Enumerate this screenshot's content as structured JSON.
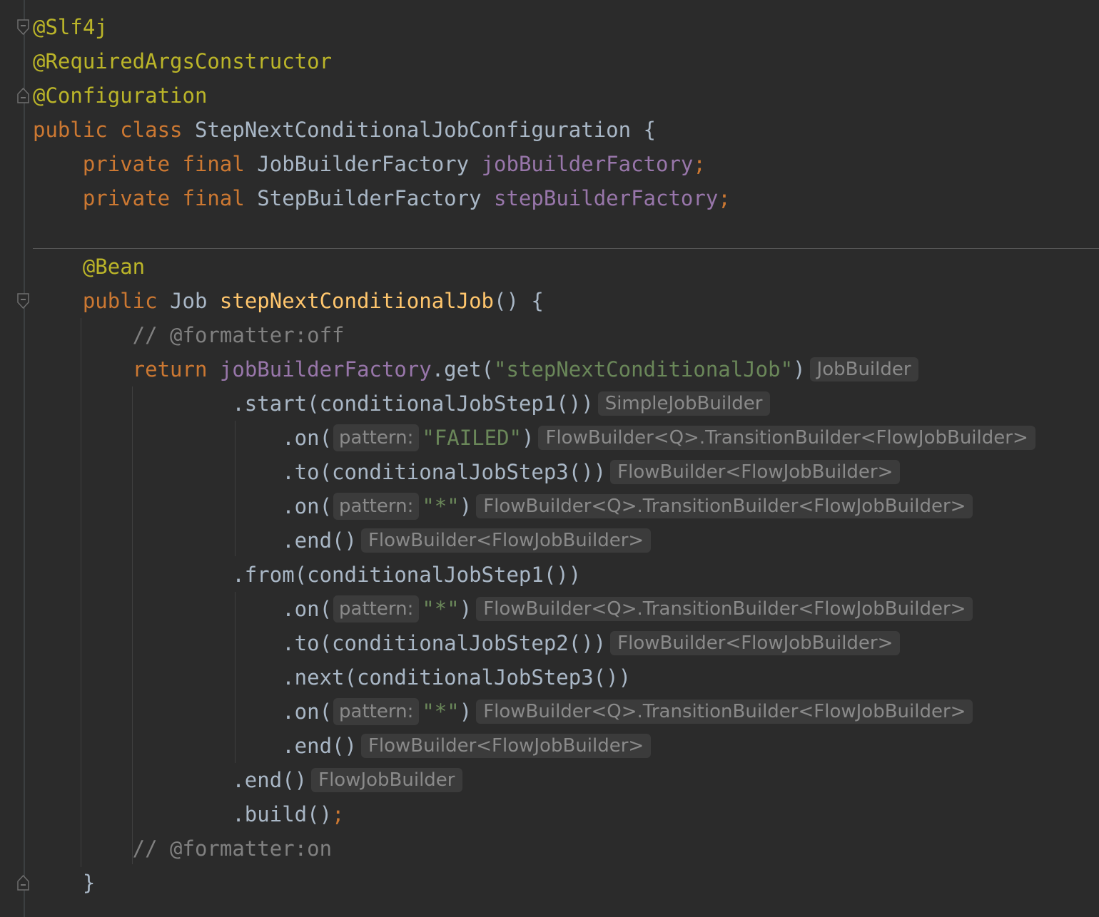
{
  "editor": {
    "lines": [
      [
        {
          "c": "ann",
          "t": "@Slf4j"
        }
      ],
      [
        {
          "c": "ann",
          "t": "@RequiredArgsConstructor"
        }
      ],
      [
        {
          "c": "ann",
          "t": "@Configuration"
        }
      ],
      [
        {
          "c": "kw",
          "t": "public class "
        },
        {
          "c": "cls",
          "t": "StepNextConditionalJobConfiguration "
        },
        {
          "c": "plain",
          "t": "{"
        }
      ],
      [
        {
          "c": "kw",
          "t": "    private final "
        },
        {
          "c": "cls",
          "t": "JobBuilderFactory "
        },
        {
          "c": "field",
          "t": "jobBuilderFactory"
        },
        {
          "c": "kw",
          "t": ";"
        }
      ],
      [
        {
          "c": "kw",
          "t": "    private final "
        },
        {
          "c": "cls",
          "t": "StepBuilderFactory "
        },
        {
          "c": "field",
          "t": "stepBuilderFactory"
        },
        {
          "c": "kw",
          "t": ";"
        }
      ],
      [],
      [
        {
          "c": "ann",
          "t": "    @Bean"
        }
      ],
      [
        {
          "c": "kw",
          "t": "    public "
        },
        {
          "c": "cls",
          "t": "Job "
        },
        {
          "c": "method",
          "t": "stepNextConditionalJob"
        },
        {
          "c": "plain",
          "t": "() {"
        }
      ],
      [
        {
          "c": "cmt",
          "t": "        // @formatter:off"
        }
      ],
      [
        {
          "c": "kw",
          "t": "        return "
        },
        {
          "c": "field",
          "t": "jobBuilderFactory"
        },
        {
          "c": "plain",
          "t": ".get("
        },
        {
          "c": "str",
          "t": "\"stepNextConditionalJob\""
        },
        {
          "c": "plain",
          "t": ")"
        },
        {
          "h": "JobBuilder"
        }
      ],
      [
        {
          "c": "plain",
          "t": "                .start(conditionalJobStep1())"
        },
        {
          "h": "SimpleJobBuilder"
        }
      ],
      [
        {
          "c": "plain",
          "t": "                    .on("
        },
        {
          "p": "pattern:"
        },
        {
          "c": "str",
          "t": "\"FAILED\""
        },
        {
          "c": "plain",
          "t": ")"
        },
        {
          "h": "FlowBuilder<Q>.TransitionBuilder<FlowJobBuilder>"
        }
      ],
      [
        {
          "c": "plain",
          "t": "                    .to(conditionalJobStep3())"
        },
        {
          "h": "FlowBuilder<FlowJobBuilder>"
        }
      ],
      [
        {
          "c": "plain",
          "t": "                    .on("
        },
        {
          "p": "pattern:"
        },
        {
          "c": "str",
          "t": "\"*\""
        },
        {
          "c": "plain",
          "t": ")"
        },
        {
          "h": "FlowBuilder<Q>.TransitionBuilder<FlowJobBuilder>"
        }
      ],
      [
        {
          "c": "plain",
          "t": "                    .end()"
        },
        {
          "h": "FlowBuilder<FlowJobBuilder>"
        }
      ],
      [
        {
          "c": "plain",
          "t": "                .from(conditionalJobStep1())"
        }
      ],
      [
        {
          "c": "plain",
          "t": "                    .on("
        },
        {
          "p": "pattern:"
        },
        {
          "c": "str",
          "t": "\"*\""
        },
        {
          "c": "plain",
          "t": ")"
        },
        {
          "h": "FlowBuilder<Q>.TransitionBuilder<FlowJobBuilder>"
        }
      ],
      [
        {
          "c": "plain",
          "t": "                    .to(conditionalJobStep2())"
        },
        {
          "h": "FlowBuilder<FlowJobBuilder>"
        }
      ],
      [
        {
          "c": "plain",
          "t": "                    .next(conditionalJobStep3())"
        }
      ],
      [
        {
          "c": "plain",
          "t": "                    .on("
        },
        {
          "p": "pattern:"
        },
        {
          "c": "str",
          "t": "\"*\""
        },
        {
          "c": "plain",
          "t": ")"
        },
        {
          "h": "FlowBuilder<Q>.TransitionBuilder<FlowJobBuilder>"
        }
      ],
      [
        {
          "c": "plain",
          "t": "                    .end()"
        },
        {
          "h": "FlowBuilder<FlowJobBuilder>"
        }
      ],
      [
        {
          "c": "plain",
          "t": "                .end()"
        },
        {
          "h": "FlowJobBuilder"
        }
      ],
      [
        {
          "c": "plain",
          "t": "                .build()"
        },
        {
          "c": "kw",
          "t": ";"
        }
      ],
      [
        {
          "c": "cmt",
          "t": "        // @formatter:on"
        }
      ],
      [
        {
          "c": "plain",
          "t": "    }"
        }
      ]
    ],
    "fold_markers": [
      {
        "line": 0,
        "kind": "open"
      },
      {
        "line": 2,
        "kind": "close"
      },
      {
        "line": 8,
        "kind": "open"
      },
      {
        "line": 25,
        "kind": "close"
      }
    ]
  }
}
